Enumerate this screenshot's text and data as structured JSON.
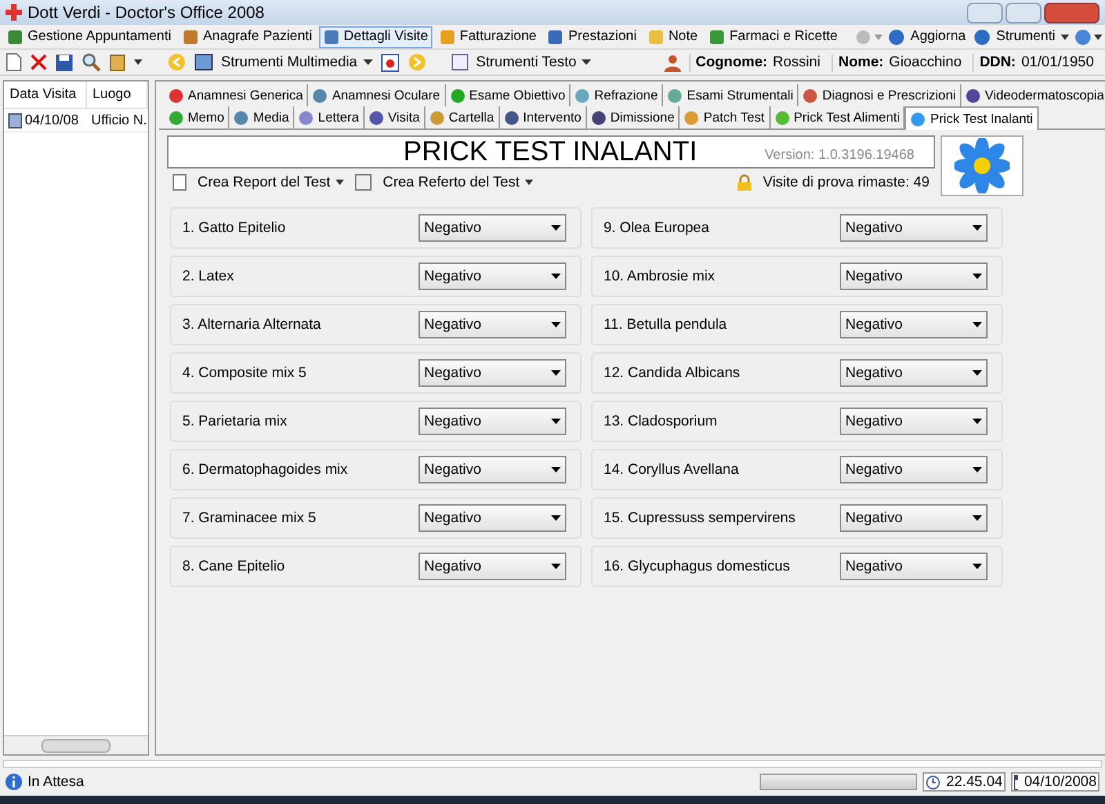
{
  "window": {
    "title": "Dott Verdi - Doctor's Office 2008"
  },
  "menu": [
    {
      "label": "Gestione Appuntamenti",
      "selected": false
    },
    {
      "label": "Anagrafe Pazienti",
      "selected": false
    },
    {
      "label": "Dettagli Visite",
      "selected": true
    },
    {
      "label": "Fatturazione",
      "selected": false
    },
    {
      "label": "Prestazioni",
      "selected": false
    },
    {
      "label": "Note",
      "selected": false
    },
    {
      "label": "Farmaci e Ricette",
      "selected": false
    }
  ],
  "menu_right": [
    "Aggiorna",
    "Strumenti"
  ],
  "toolbar": {
    "multimedia": "Strumenti Multimedia",
    "testo": "Strumenti Testo",
    "patient": [
      {
        "label": "Cognome:",
        "value": "Rossini"
      },
      {
        "label": "Nome:",
        "value": "Gioacchino"
      },
      {
        "label": "DDN:",
        "value": "01/01/1950"
      }
    ]
  },
  "visits": {
    "columns": [
      "Data Visita",
      "Luogo"
    ],
    "rows": [
      [
        "04/10/08",
        "Ufficio N."
      ]
    ]
  },
  "tabs_row1": [
    {
      "label": "Anamnesi Generica",
      "selected": false
    },
    {
      "label": "Anamnesi Oculare",
      "selected": false
    },
    {
      "label": "Esame Obiettivo",
      "selected": false
    },
    {
      "label": "Refrazione",
      "selected": false
    },
    {
      "label": "Esami Strumentali",
      "selected": false
    },
    {
      "label": "Diagnosi e Prescrizioni",
      "selected": false
    },
    {
      "label": "Videodermatoscopia",
      "selected": false
    }
  ],
  "tabs_row2": [
    {
      "label": "Memo",
      "selected": false
    },
    {
      "label": "Media",
      "selected": false
    },
    {
      "label": "Lettera",
      "selected": false
    },
    {
      "label": "Visita",
      "selected": false
    },
    {
      "label": "Cartella",
      "selected": false
    },
    {
      "label": "Intervento",
      "selected": false
    },
    {
      "label": "Dimissione",
      "selected": false
    },
    {
      "label": "Patch Test",
      "selected": false
    },
    {
      "label": "Prick Test Alimenti",
      "selected": false
    },
    {
      "label": "Prick Test Inalanti",
      "selected": true
    }
  ],
  "panel": {
    "title": "PRICK TEST INALANTI",
    "version": "Version: 1.0.3196.19468",
    "report": "Crea Report del Test",
    "referto": "Crea Referto del Test",
    "trial": "Visite di prova rimaste: 49"
  },
  "tests": [
    {
      "label": "1. Gatto Epitelio",
      "value": "Negativo"
    },
    {
      "label": "2. Latex",
      "value": "Negativo"
    },
    {
      "label": "3. Alternaria Alternata",
      "value": "Negativo"
    },
    {
      "label": "4. Composite mix 5",
      "value": "Negativo"
    },
    {
      "label": "5. Parietaria mix",
      "value": "Negativo"
    },
    {
      "label": "6. Dermatophagoides mix",
      "value": "Negativo"
    },
    {
      "label": "7. Graminacee mix 5",
      "value": "Negativo"
    },
    {
      "label": "8. Cane Epitelio",
      "value": "Negativo"
    },
    {
      "label": "9. Olea Europea",
      "value": "Negativo"
    },
    {
      "label": "10. Ambrosie mix",
      "value": "Negativo"
    },
    {
      "label": "11. Betulla pendula",
      "value": "Negativo"
    },
    {
      "label": "12. Candida Albicans",
      "value": "Negativo"
    },
    {
      "label": "13. Cladosporium",
      "value": "Negativo"
    },
    {
      "label": "14. Coryllus Avellana",
      "value": "Negativo"
    },
    {
      "label": "15. Cupressuss sempervirens",
      "value": "Negativo"
    },
    {
      "label": "16. Glycuphagus domesticus",
      "value": "Negativo"
    }
  ],
  "status_bar": {
    "status": "In Attesa",
    "progress": {
      "level": 0
    },
    "time": "22.45.04",
    "date": "04/10/2008"
  }
}
